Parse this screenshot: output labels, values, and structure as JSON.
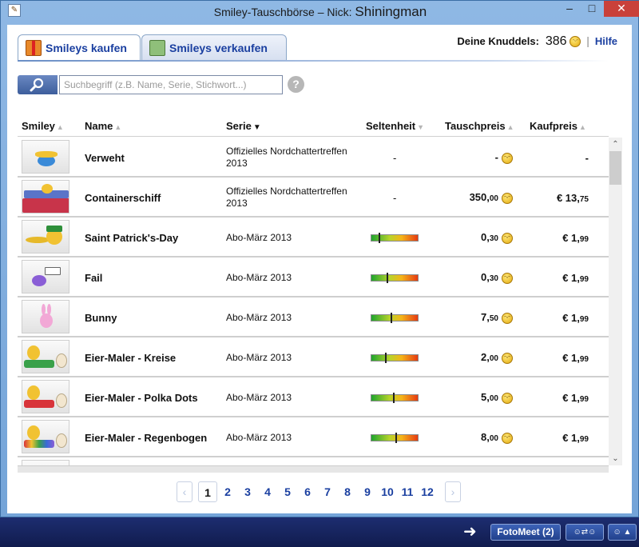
{
  "window": {
    "title_prefix": "Smiley-Tauschbörse – Nick:",
    "nick": "Shiningman",
    "minimize": "–",
    "maximize": "□",
    "close": "✕"
  },
  "tabs": [
    {
      "label": "Smileys kaufen",
      "icon": "gift-icon",
      "active": true
    },
    {
      "label": "Smileys verkaufen",
      "icon": "money-stack-icon",
      "active": false
    }
  ],
  "account": {
    "label": "Deine Knuddels:",
    "value": "386",
    "separator": "|",
    "help": "Hilfe"
  },
  "search": {
    "placeholder": "Suchbegriff (z.B. Name, Serie, Stichwort...)",
    "value": "",
    "help_glyph": "?"
  },
  "table": {
    "headers": {
      "smiley": "Smiley",
      "name": "Name",
      "serie": "Serie",
      "rarity": "Seltenheit",
      "trade_price": "Tauschpreis",
      "buy_price": "Kaufpreis"
    },
    "sort_up": "▲",
    "sort_down": "▼",
    "rows": [
      {
        "name": "Verweht",
        "serie": "Offizielles Nordchattertreffen 2013",
        "rarity": "-",
        "rarity_level": null,
        "price": "-",
        "kauf_int": "-",
        "kauf_cents": ""
      },
      {
        "name": "Containerschiff",
        "serie": "Offizielles Nordchattertreffen 2013",
        "rarity": "-",
        "rarity_level": null,
        "price_int": "350,",
        "price_cents": "00",
        "kauf_int": "€ 13,",
        "kauf_cents": "75"
      },
      {
        "name": "Saint Patrick's-Day",
        "serie": "Abo-März 2013",
        "rarity_level": 0.15,
        "price_int": "0,",
        "price_cents": "30",
        "kauf_int": "€ 1,",
        "kauf_cents": "99"
      },
      {
        "name": "Fail",
        "serie": "Abo-März 2013",
        "rarity_level": 0.33,
        "price_int": "0,",
        "price_cents": "30",
        "kauf_int": "€ 1,",
        "kauf_cents": "99"
      },
      {
        "name": "Bunny",
        "serie": "Abo-März 2013",
        "rarity_level": 0.42,
        "price_int": "7,",
        "price_cents": "50",
        "kauf_int": "€ 1,",
        "kauf_cents": "99"
      },
      {
        "name": "Eier-Maler - Kreise",
        "serie": "Abo-März 2013",
        "rarity_level": 0.3,
        "price_int": "2,",
        "price_cents": "00",
        "kauf_int": "€ 1,",
        "kauf_cents": "99"
      },
      {
        "name": "Eier-Maler - Polka Dots",
        "serie": "Abo-März 2013",
        "rarity_level": 0.47,
        "price_int": "5,",
        "price_cents": "00",
        "kauf_int": "€ 1,",
        "kauf_cents": "99"
      },
      {
        "name": "Eier-Maler - Regenbogen",
        "serie": "Abo-März 2013",
        "rarity_level": 0.52,
        "price_int": "8,",
        "price_cents": "00",
        "kauf_int": "€ 1,",
        "kauf_cents": "99"
      }
    ]
  },
  "pagination": {
    "prev": "‹",
    "next": "›",
    "pages": [
      "1",
      "2",
      "3",
      "4",
      "5",
      "6",
      "7",
      "8",
      "9",
      "10",
      "11",
      "12"
    ],
    "current": "1"
  },
  "taskbar": {
    "fotomeet": "FotoMeet (2)",
    "tray_a": "☺⇄☺",
    "tray_b": "☺ ▲"
  },
  "colors": {
    "accent": "#1a3fa0",
    "taskbar": "#16235e",
    "close_button": "#c9413a"
  }
}
